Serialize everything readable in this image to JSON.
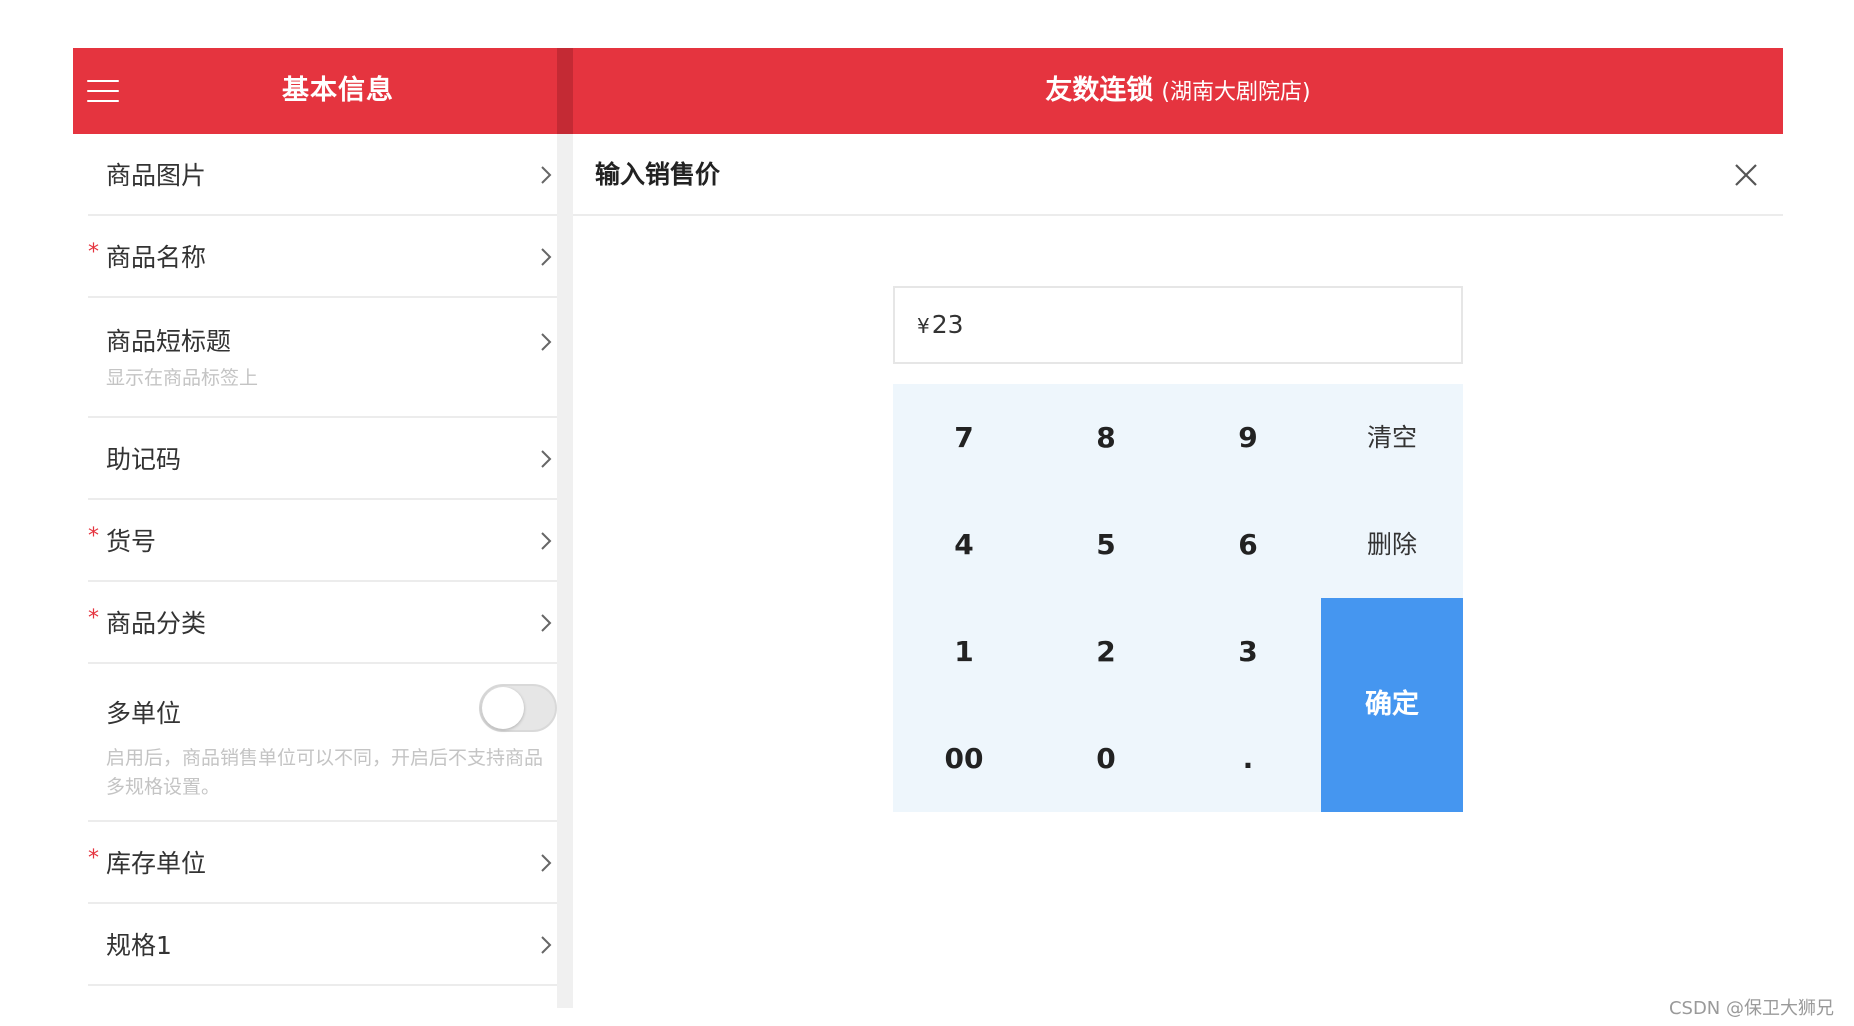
{
  "header": {
    "left_title": "基本信息",
    "right_title": "友数连锁",
    "right_subtitle": "(湖南大剧院店)"
  },
  "form": {
    "rows": [
      {
        "required": false,
        "label": "商品图片",
        "hint": ""
      },
      {
        "required": true,
        "label": "商品名称",
        "hint": ""
      },
      {
        "required": false,
        "label": "商品短标题",
        "hint": "显示在商品标签上"
      },
      {
        "required": false,
        "label": "助记码",
        "hint": ""
      },
      {
        "required": true,
        "label": "货号",
        "hint": ""
      },
      {
        "required": true,
        "label": "商品分类",
        "hint": ""
      },
      {
        "required": false,
        "label": "多单位",
        "hint": "启用后，商品销售单位可以不同，开启后不支持商品多规格设置。",
        "toggle_on": false
      },
      {
        "required": true,
        "label": "库存单位",
        "hint": ""
      },
      {
        "required": false,
        "label": "规格1",
        "hint": ""
      }
    ],
    "required_mark": "*"
  },
  "dialog": {
    "title": "输入销售价",
    "currency_symbol": "¥",
    "price_value": "23"
  },
  "keypad": {
    "k7": "7",
    "k8": "8",
    "k9": "9",
    "clear": "清空",
    "k4": "4",
    "k5": "5",
    "k6": "6",
    "delete": "删除",
    "k1": "1",
    "k2": "2",
    "k3": "3",
    "confirm": "确定",
    "k00": "00",
    "k0": "0",
    "dot": "."
  },
  "watermark": "CSDN @保卫大狮兄",
  "colors": {
    "brand_red": "#e5343f",
    "confirm_blue": "#4596f0",
    "keypad_bg": "#eef6fc"
  }
}
